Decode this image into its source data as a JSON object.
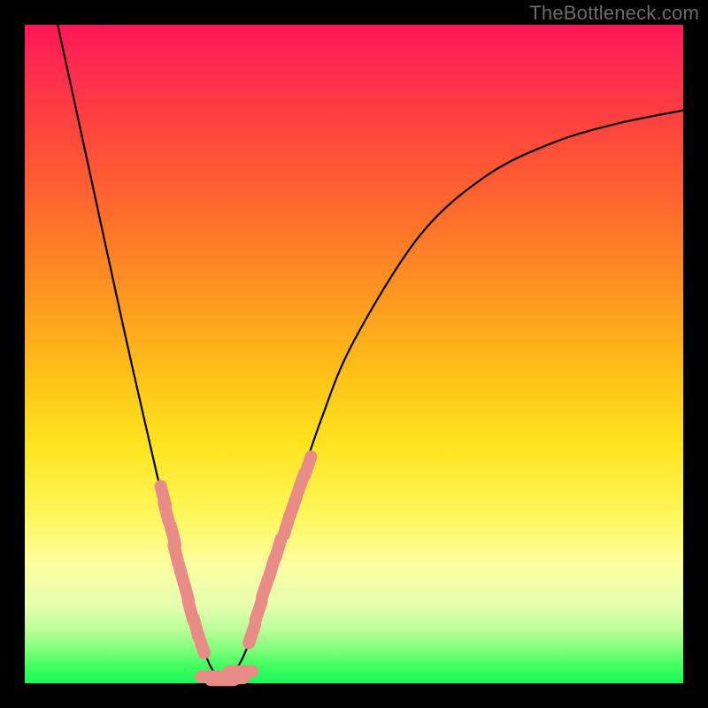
{
  "watermark": "TheBottleneck.com",
  "chart_data": {
    "type": "line",
    "title": "",
    "xlabel": "",
    "ylabel": "",
    "xlim": [
      0,
      1
    ],
    "ylim": [
      0,
      1
    ],
    "curve": {
      "description": "V-shaped bottleneck curve; minimum near x≈0.30 at y≈0",
      "x": [
        0.05,
        0.1,
        0.15,
        0.2,
        0.23,
        0.26,
        0.28,
        0.3,
        0.32,
        0.34,
        0.37,
        0.4,
        0.45,
        0.5,
        0.6,
        0.7,
        0.8,
        0.9,
        1.0
      ],
      "y": [
        1.0,
        0.77,
        0.54,
        0.32,
        0.2,
        0.09,
        0.03,
        0.005,
        0.02,
        0.06,
        0.15,
        0.25,
        0.4,
        0.52,
        0.68,
        0.77,
        0.82,
        0.85,
        0.87
      ]
    },
    "highlight_segments": {
      "description": "Salmon-colored discrete marker segments near the valley, split into left-wall cluster and right-wall cluster plus flat bottom",
      "color": "#e98b87",
      "left": [
        {
          "x": 0.21,
          "y": 0.285
        },
        {
          "x": 0.215,
          "y": 0.26
        },
        {
          "x": 0.225,
          "y": 0.225
        },
        {
          "x": 0.23,
          "y": 0.195
        },
        {
          "x": 0.238,
          "y": 0.165
        },
        {
          "x": 0.245,
          "y": 0.14
        },
        {
          "x": 0.252,
          "y": 0.11
        },
        {
          "x": 0.26,
          "y": 0.085
        },
        {
          "x": 0.268,
          "y": 0.06
        }
      ],
      "bottom": [
        {
          "x": 0.285,
          "y": 0.01
        },
        {
          "x": 0.3,
          "y": 0.005
        },
        {
          "x": 0.315,
          "y": 0.008
        },
        {
          "x": 0.328,
          "y": 0.018
        }
      ],
      "right": [
        {
          "x": 0.345,
          "y": 0.075
        },
        {
          "x": 0.355,
          "y": 0.11
        },
        {
          "x": 0.365,
          "y": 0.145
        },
        {
          "x": 0.375,
          "y": 0.175
        },
        {
          "x": 0.385,
          "y": 0.205
        },
        {
          "x": 0.398,
          "y": 0.24
        },
        {
          "x": 0.408,
          "y": 0.27
        },
        {
          "x": 0.42,
          "y": 0.305
        },
        {
          "x": 0.43,
          "y": 0.33
        }
      ]
    }
  }
}
